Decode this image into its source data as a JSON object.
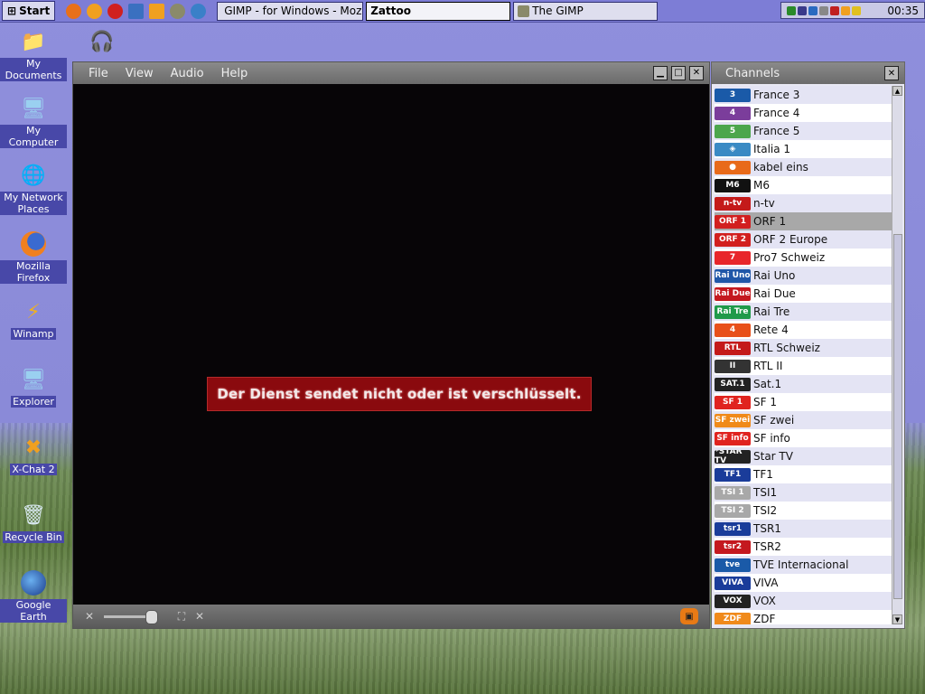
{
  "taskbar": {
    "start_label": "Start",
    "tasks": [
      {
        "label": "GIMP - for Windows - Mozill..."
      },
      {
        "label": "Zattoo"
      },
      {
        "label": "The GIMP"
      }
    ],
    "clock": "00:35"
  },
  "desktop": {
    "icons": [
      {
        "label": "My Documents",
        "icon": "folder-icon"
      },
      {
        "label": "My Computer",
        "icon": "computer-icon"
      },
      {
        "label": "My Network Places",
        "icon": "network-icon"
      },
      {
        "label": "Mozilla Firefox",
        "icon": "firefox-icon"
      },
      {
        "label": "Winamp",
        "icon": "winamp-icon"
      },
      {
        "label": "Explorer",
        "icon": "explorer-icon"
      },
      {
        "label": "X-Chat 2",
        "icon": "xchat-icon"
      },
      {
        "label": "Recycle Bin",
        "icon": "recycle-bin-icon"
      },
      {
        "label": "Google Earth",
        "icon": "google-earth-icon"
      }
    ]
  },
  "player": {
    "menu": {
      "file": "File",
      "view": "View",
      "audio": "Audio",
      "help": "Help"
    },
    "message": "Der Dienst sendet nicht oder ist verschlüsselt.",
    "volume": 1.0
  },
  "channels": {
    "title": "Channels",
    "items": [
      {
        "name": "France 3",
        "logo": "3",
        "color": "#1a5aa8"
      },
      {
        "name": "France 4",
        "logo": "4",
        "color": "#7b3d9b"
      },
      {
        "name": "France 5",
        "logo": "5",
        "color": "#4ca64c"
      },
      {
        "name": "Italia 1",
        "logo": "◈",
        "color": "#3a8ac4"
      },
      {
        "name": "kabel eins",
        "logo": "●",
        "color": "#e86a1a"
      },
      {
        "name": "M6",
        "logo": "M6",
        "color": "#111111"
      },
      {
        "name": "n-tv",
        "logo": "n-tv",
        "color": "#c41a1a"
      },
      {
        "name": "ORF 1",
        "logo": "ORF 1",
        "color": "#d21f1f"
      },
      {
        "name": "ORF 2 Europe",
        "logo": "ORF 2",
        "color": "#d21f1f"
      },
      {
        "name": "Pro7 Schweiz",
        "logo": "7",
        "color": "#e8262b"
      },
      {
        "name": "Rai Uno",
        "logo": "Rai Uno",
        "color": "#2057a8"
      },
      {
        "name": "Rai Due",
        "logo": "Rai Due",
        "color": "#c4181f"
      },
      {
        "name": "Rai Tre",
        "logo": "Rai Tre",
        "color": "#209a4a"
      },
      {
        "name": "Rete 4",
        "logo": "4",
        "color": "#e8501a"
      },
      {
        "name": "RTL Schweiz",
        "logo": "RTL",
        "color": "#c41a1a"
      },
      {
        "name": "RTL II",
        "logo": "II",
        "color": "#333333"
      },
      {
        "name": "Sat.1",
        "logo": "SAT.1",
        "color": "#222222"
      },
      {
        "name": "SF 1",
        "logo": "SF 1",
        "color": "#e0231f"
      },
      {
        "name": "SF zwei",
        "logo": "SF zwei",
        "color": "#f08a1a"
      },
      {
        "name": "SF info",
        "logo": "SF info",
        "color": "#e0231f"
      },
      {
        "name": "Star TV",
        "logo": "*STAR TV",
        "color": "#222222"
      },
      {
        "name": "TF1",
        "logo": "TF1",
        "color": "#1a3c9a"
      },
      {
        "name": "TSI1",
        "logo": "TSI 1",
        "color": "#a8a8a8"
      },
      {
        "name": "TSI2",
        "logo": "TSI 2",
        "color": "#a8a8a8"
      },
      {
        "name": "TSR1",
        "logo": "tsr1",
        "color": "#1a3c9a"
      },
      {
        "name": "TSR2",
        "logo": "tsr2",
        "color": "#c4181f"
      },
      {
        "name": "TVE Internacional",
        "logo": "tve",
        "color": "#1a5aa8"
      },
      {
        "name": "VIVA",
        "logo": "VIVA",
        "color": "#1a3c9a"
      },
      {
        "name": "VOX",
        "logo": "VOX",
        "color": "#222222"
      },
      {
        "name": "ZDF",
        "logo": "ZDF",
        "color": "#f08a1a"
      }
    ],
    "selected": "ORF 1"
  }
}
